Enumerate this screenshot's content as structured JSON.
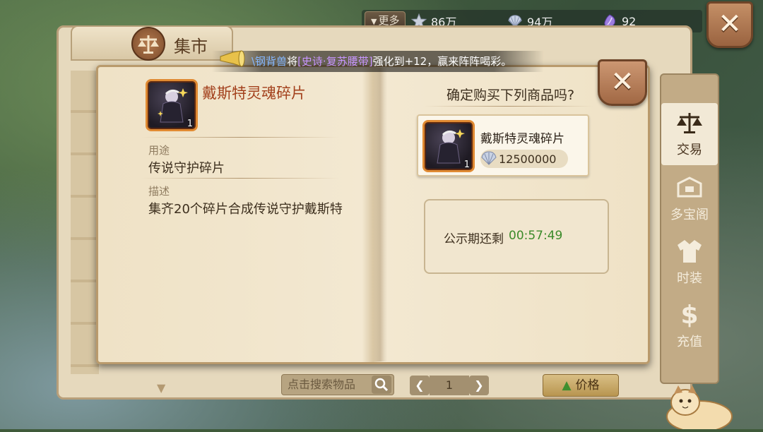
{
  "topbar": {
    "more_label": "更多",
    "resources": [
      {
        "icon": "star-icon",
        "value": "86万"
      },
      {
        "icon": "shell-icon",
        "value": "94万"
      },
      {
        "icon": "crystal-icon",
        "value": "92"
      }
    ]
  },
  "market": {
    "title": "集市",
    "search_placeholder": "点击搜索物品",
    "page": "1",
    "price_sort_label": "价格"
  },
  "sidenav": [
    {
      "label": "交易",
      "icon": "scale-icon",
      "active": true
    },
    {
      "label": "多宝阁",
      "icon": "treasure-chest-icon",
      "active": false
    },
    {
      "label": "时装",
      "icon": "fashion-icon",
      "active": false
    },
    {
      "label": "充值",
      "icon": "dollar-icon",
      "active": false
    }
  ],
  "broadcast": {
    "user": "\\钢背兽",
    "verb": "将",
    "item": "[史诗·复苏腰带]",
    "rest": "强化到+12，赢来阵阵喝彩。"
  },
  "dialog": {
    "item": {
      "name": "戴斯特灵魂碎片",
      "count": "1",
      "usage_label": "用途",
      "usage_value": "传说守护碎片",
      "desc_label": "描述",
      "desc_value": "集齐20个碎片合成传说守护戴斯特"
    },
    "confirm_question": "确定购买下列商品吗?",
    "product": {
      "name": "戴斯特灵魂碎片",
      "count": "1",
      "price": "12500000"
    },
    "timer": {
      "label": "公示期还剩",
      "value": "00:57:49"
    }
  },
  "colors": {
    "item_name": "#a3411d",
    "timer_value": "#3b8a2a",
    "broadcast_user": "#86b8ff",
    "broadcast_item": "#c896ff"
  }
}
